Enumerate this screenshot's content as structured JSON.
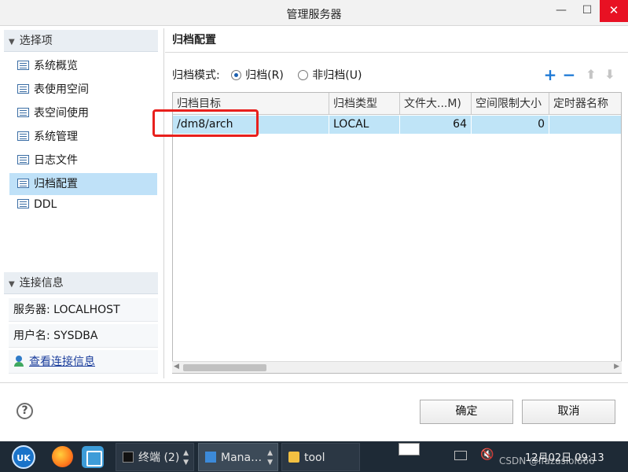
{
  "window": {
    "title": "管理服务器",
    "min_glyph": "—",
    "max_glyph": "☐",
    "close_glyph": "✕"
  },
  "sidebar": {
    "options_header": "选择项",
    "items": [
      {
        "label": "系统概览"
      },
      {
        "label": "表使用空间"
      },
      {
        "label": "表空间使用"
      },
      {
        "label": "系统管理"
      },
      {
        "label": "日志文件"
      },
      {
        "label": "归档配置"
      },
      {
        "label": "DDL"
      }
    ],
    "selected_index": 5,
    "connection_header": "连接信息",
    "server_line": "服务器: LOCALHOST",
    "user_line": "用户名: SYSDBA",
    "view_link": "查看连接信息"
  },
  "main": {
    "title": "归档配置",
    "mode_label": "归档模式:",
    "mode_options": [
      {
        "label": "归档(R)",
        "checked": true
      },
      {
        "label": "非归档(U)",
        "checked": false
      }
    ],
    "toolbar_icons": [
      "plus-icon",
      "minus-icon",
      "arrow-up-icon",
      "arrow-down-icon"
    ],
    "table": {
      "columns": [
        "归档目标",
        "归档类型",
        "文件大...M)",
        "空间限制大小",
        "定时器名称"
      ],
      "rows": [
        [
          "/dm8/arch",
          "LOCAL",
          "64",
          "0",
          ""
        ]
      ]
    }
  },
  "buttons": {
    "ok": "确定",
    "cancel": "取消",
    "help_glyph": "?"
  },
  "taskbar": {
    "logo_text": "UK",
    "tasks": [
      {
        "label": "终端 (2)"
      },
      {
        "label": "Mana…"
      },
      {
        "label": "tool"
      }
    ],
    "clock": "12月02日 09:13",
    "watermark": "CSDN @lfazaslol666"
  },
  "colors": {
    "selection": "#bfe1f8",
    "row_selected": "#bfe4f7",
    "accent_blue": "#1f7ad6",
    "highlight_box": "#e8201d",
    "taskbar": "#1e2a36"
  }
}
